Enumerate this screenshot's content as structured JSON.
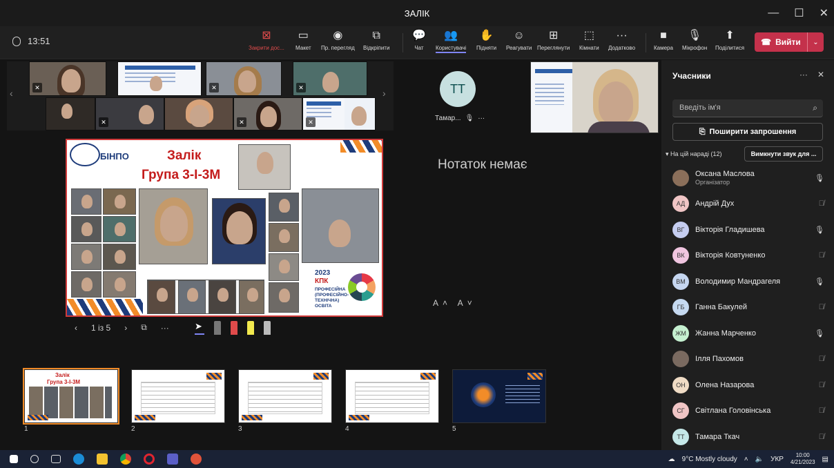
{
  "window": {
    "title": "ЗАЛІК",
    "controls": [
      "—",
      "☐",
      "✕"
    ]
  },
  "toolbar": {
    "time": "13:51",
    "stop_share": "Закрити дос...",
    "layout": "Макет",
    "pr_view": "Пр. перегляд",
    "unpin": "Відкріпити",
    "chat": "Чат",
    "people": "Користувачі",
    "raise": "Підняти",
    "react": "Реагувати",
    "view": "Переглянути",
    "rooms": "Кімнати",
    "more": "Додатково",
    "camera": "Камера",
    "mic": "Мікрофон",
    "share": "Поділитися",
    "leave": "Вийти"
  },
  "slide": {
    "logo": "БІНПО",
    "title1": "Залік",
    "title2": "Група 3-І-3М",
    "kpk_year": "2023",
    "kpk_label": "КПК",
    "kpk_desc": "ПРОФЕСІЙНА (ПРОФЕСІЙНО-ТЕХНІЧНА) ОСВІТА"
  },
  "slide_nav": {
    "counter": "1 із 5"
  },
  "thumbnails": [
    {
      "num": "1",
      "title_a": "Залік",
      "title_b": "Група 3-І-3М"
    },
    {
      "num": "2"
    },
    {
      "num": "3"
    },
    {
      "num": "4"
    },
    {
      "num": "5"
    }
  ],
  "middle": {
    "avatar_initials": "ТТ",
    "avatar_name": "Тамар...",
    "notes_empty": "Нотаток немає",
    "font_controls": "A˄ A˅"
  },
  "panel": {
    "title": "Учасники",
    "search_placeholder": "Введіть ім'я",
    "invite": "Поширити запрошення",
    "in_meeting": "На цій нараді (12)",
    "mute_all": "Вимкнути звук для ...",
    "participants": [
      {
        "initials": "",
        "name": "Оксана Маслова",
        "role": "Організатор",
        "color": "#8b6f5a",
        "mic": "on"
      },
      {
        "initials": "АД",
        "name": "Андрій Дух",
        "color": "#f0c5c5",
        "mic": "off"
      },
      {
        "initials": "ВГ",
        "name": "Вікторія Гладишева",
        "color": "#c5cdf0",
        "mic": "on"
      },
      {
        "initials": "ВК",
        "name": "Вікторія Ковтуненко",
        "color": "#f0c5e0",
        "mic": "off"
      },
      {
        "initials": "ВМ",
        "name": "Володимир Мандрагеля",
        "color": "#c5d6f0",
        "mic": "on"
      },
      {
        "initials": "ГБ",
        "name": "Ганна Бакулей",
        "color": "#c5d9f0",
        "mic": "off"
      },
      {
        "initials": "ЖМ",
        "name": "Жанна Марченко",
        "color": "#c5f0d0",
        "mic": "on"
      },
      {
        "initials": "",
        "name": "Ілля Пахомов",
        "color": "#7a6a60",
        "mic": "off"
      },
      {
        "initials": "ОН",
        "name": "Олена Назарова",
        "color": "#f0dcc5",
        "mic": "off"
      },
      {
        "initials": "СГ",
        "name": "Світлана Головінська",
        "color": "#f0c5c5",
        "mic": "off"
      },
      {
        "initials": "ТТ",
        "name": "Тамара Ткач",
        "color": "#c5e8e8",
        "mic": "off"
      }
    ]
  },
  "taskbar": {
    "weather": "9°C Mostly cloudy",
    "lang": "УКР",
    "time": "10:00",
    "date": "4/21/2023"
  }
}
